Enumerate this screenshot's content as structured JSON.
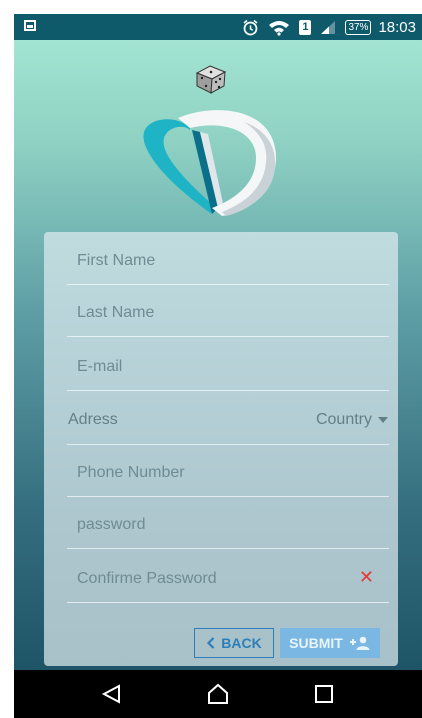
{
  "status_bar": {
    "battery": "37%",
    "time": "18:03",
    "sim_slot": "1",
    "icons": [
      "screenshot-icon",
      "alarm-icon",
      "wifi-icon",
      "sim-icon",
      "signal-icon",
      "battery-icon"
    ]
  },
  "logo": {
    "name": "app-logo",
    "colors": {
      "accent": "#1fb3c6",
      "dark_accent": "#0b6f8a",
      "face": "#f2f2f2"
    }
  },
  "form": {
    "first_name_placeholder": "First Name",
    "last_name_placeholder": "Last Name",
    "email_placeholder": "E-mail",
    "address_label": "Adress",
    "country_select": "Country",
    "phone_placeholder": "Phone Number",
    "password_placeholder": "password",
    "confirm_password_placeholder": "Confirme Password",
    "clear_icon": "✕"
  },
  "buttons": {
    "back_label": "BACK",
    "submit_label": "SUBMIT"
  },
  "nav": {
    "items": [
      "back-nav",
      "home-nav",
      "recents-nav"
    ]
  },
  "colors": {
    "status_bar": "#0e5a6a",
    "gradient_top": "#a8e9d6",
    "gradient_bottom": "#174c5f",
    "back_button": "#2c7fb8",
    "submit_button": "#7ab8e3",
    "error": "#e53935"
  }
}
